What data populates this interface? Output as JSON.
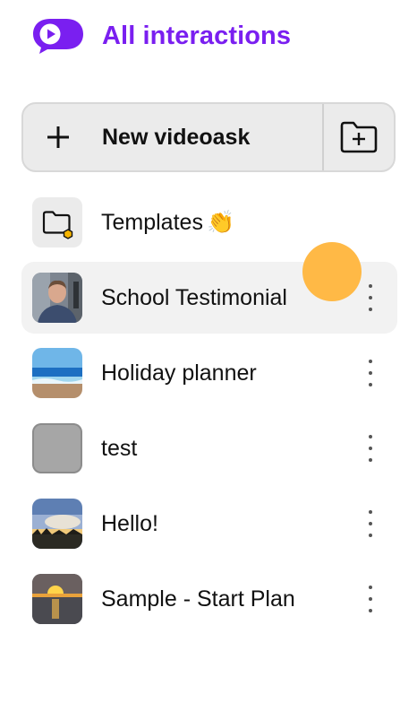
{
  "header": {
    "title": "All interactions",
    "logo_icon": "videoask-logo-icon",
    "accent_color": "#7a1ff0"
  },
  "toolbar": {
    "new_label": "New videoask",
    "new_icon": "plus-icon",
    "folder_icon": "folder-add-icon"
  },
  "items": [
    {
      "label": "Templates",
      "suffix": "👏",
      "thumb": "folder-icon",
      "active": false,
      "has_menu": false
    },
    {
      "label": "School Testimonial",
      "thumb": "person-thumbnail",
      "active": true,
      "has_menu": true
    },
    {
      "label": "Holiday planner",
      "thumb": "beach-thumbnail",
      "active": false,
      "has_menu": true
    },
    {
      "label": "test",
      "thumb": "gray-thumbnail",
      "active": false,
      "has_menu": true
    },
    {
      "label": "Hello!",
      "thumb": "sky-thumbnail",
      "active": false,
      "has_menu": true
    },
    {
      "label": "Sample - Start Plan",
      "thumb": "sunset-thumbnail",
      "active": false,
      "has_menu": true
    }
  ],
  "cursor_color": "#ffb53c"
}
